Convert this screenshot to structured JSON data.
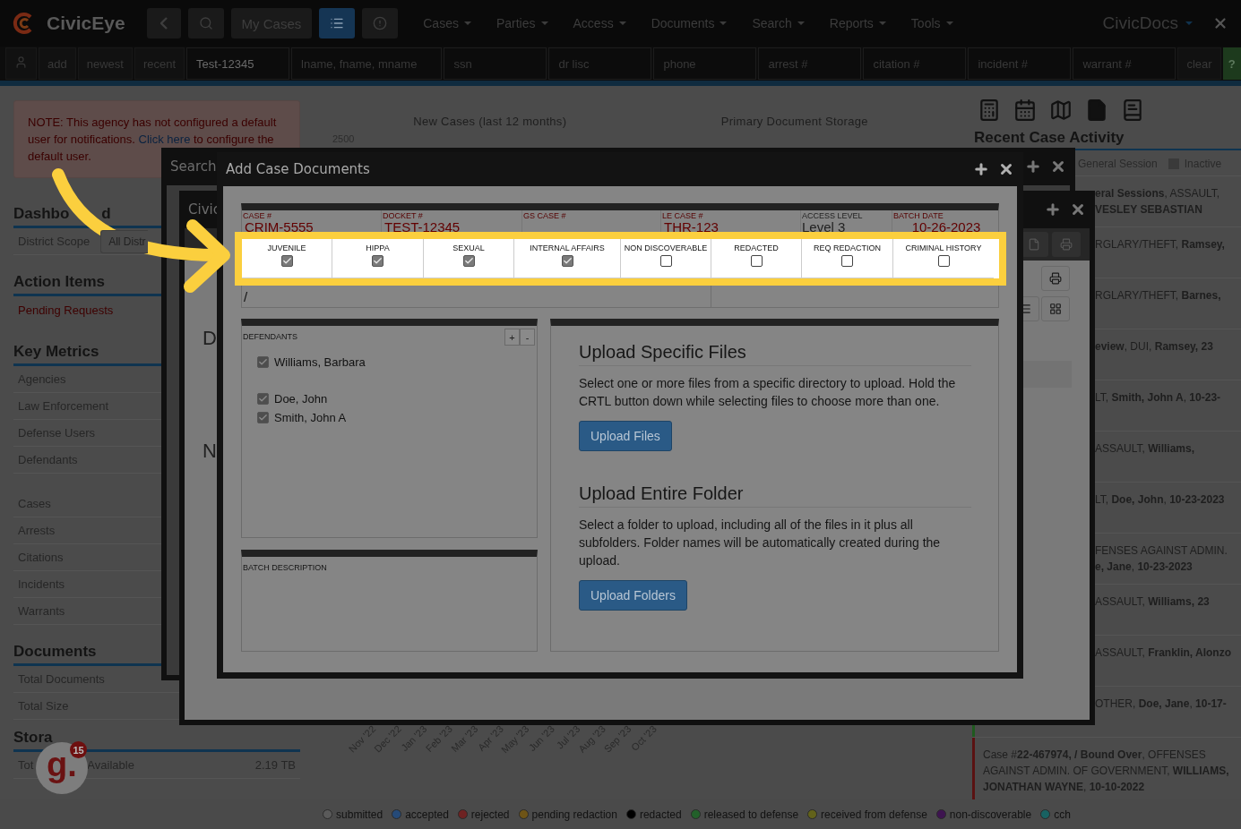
{
  "header": {
    "logo": "CivicEye",
    "tools": [
      {
        "kind": "back",
        "selected": false
      },
      {
        "kind": "search",
        "selected": false
      },
      {
        "kind": "text",
        "label": "My Cases",
        "selected": false
      },
      {
        "kind": "list",
        "selected": true
      },
      {
        "kind": "alert",
        "selected": false
      }
    ],
    "menus": [
      "Cases",
      "Parties",
      "Access",
      "Documents",
      "Search",
      "Reports",
      "Tools"
    ],
    "product": "CivicDocs"
  },
  "search_bar": {
    "buttons": [
      "add",
      "newest",
      "recent"
    ],
    "fields": [
      {
        "value": "Test-12345"
      },
      {
        "placeholder": "lname, fname, mname"
      },
      {
        "placeholder": "ssn"
      },
      {
        "placeholder": "dr lisc"
      },
      {
        "placeholder": "phone"
      },
      {
        "placeholder": "arrest #"
      },
      {
        "placeholder": "citation #"
      },
      {
        "placeholder": "incident #"
      },
      {
        "placeholder": "warrant #"
      }
    ],
    "clear": "clear",
    "help": "?"
  },
  "sidebar": {
    "notice": {
      "before": "NOTE: This agency has not configured a default user for notifications. ",
      "link": "Click here",
      "after": " to configure the default user."
    },
    "dashboard": {
      "title_parts": [
        "Dashbo",
        "d"
      ],
      "scope_label": "District Scope",
      "scope_value": "All Distr"
    },
    "action_items": {
      "title": "Action Items",
      "items": [
        "Pending Requests"
      ]
    },
    "key_metrics": {
      "title": "Key Metrics",
      "groups": [
        [
          "Agencies",
          "Law Enforcement",
          "Defense Users",
          "Defendants"
        ],
        [
          "Cases",
          "Arrests",
          "Citations",
          "Incidents",
          "Warrants"
        ]
      ]
    },
    "documents": {
      "title": "Documents",
      "items": [
        "Total Documents",
        "Total Size"
      ]
    },
    "storage": {
      "title": "Stora",
      "items": [
        {
          "label_parts": [
            "Tot",
            "Available"
          ],
          "value": "2.19 TB"
        }
      ]
    }
  },
  "center": {
    "chart_title": "New Cases (last 12 months)",
    "y_tick": "2500",
    "months": [
      "Nov '22",
      "Dec '22",
      "Jan '23",
      "Feb '23",
      "Mar '23",
      "Apr '23",
      "May '23",
      "Jun '23",
      "Jul '23",
      "Aug '23",
      "Sep '23",
      "Oct '23"
    ],
    "storage_title": "Primary Document Storage"
  },
  "activity": {
    "title": "Recent Case Activity",
    "legend": [
      "General Session",
      "Inactive"
    ],
    "items": [
      {
        "text": "**eral Sessions**, ASSAULT, **VESLEY SEBASTIAN**",
        "covered": true
      },
      {
        "text": "RGLARY/THEFT, **Ramsey,**",
        "covered": true
      },
      {
        "text": "RGLARY/THEFT, **Barnes,**",
        "covered": true
      },
      {
        "text": "**eview**, DUI, **Ramsey, 23**",
        "covered": true
      },
      {
        "text": "LT, **Smith, John A**, **10-23-**",
        "covered": true
      },
      {
        "text": "ASSAULT, **Williams,**",
        "covered": true
      },
      {
        "text": "LT, **Doe, John**, **10-23-2023**",
        "covered": true
      },
      {
        "text": "FENSES AGAINST ADMIN. **e, Jane**, **10-23-2023**",
        "covered": true
      },
      {
        "text": "ASSAULT, **Williams, 23**",
        "covered": true
      },
      {
        "text": "ASSAULT, **Franklin, Alonzo**",
        "covered": true
      },
      {
        "text": "OTHER, **Doe, Jane**, **10-17-**",
        "covered": true,
        "color": "#1f5a1f"
      },
      {
        "text": "Case #**22-467974, / Bound Over**, OFFENSES AGAINST ADMIN. OF GOVERNMENT, **WILLIAMS, JONATHAN WAYNE**, **10-10-2022**",
        "covered": false,
        "color": "#5a1212"
      }
    ]
  },
  "back_windows": [
    {
      "title": "Search"
    },
    {
      "title": "Civic",
      "letters": [
        "D",
        "N"
      ]
    }
  ],
  "modal": {
    "title": "Add Case Documents",
    "fields": [
      {
        "label": "CASE #",
        "value": "CRIM-5555"
      },
      {
        "label": "DOCKET #",
        "value": "TEST-12345"
      },
      {
        "label": "GS CASE #"
      },
      {
        "label": "LE CASE #",
        "value": "THR-123"
      },
      {
        "label": "ACCESS LEVEL",
        "value": "Level 3"
      },
      {
        "label": "BATCH DATE",
        "value": "10-26-2023"
      }
    ],
    "flags": [
      {
        "label": "JUVENILE",
        "checked": true
      },
      {
        "label": "HIPPA",
        "checked": true
      },
      {
        "label": "SEXUAL",
        "checked": true
      },
      {
        "label": "INTERNAL AFFAIRS",
        "checked": true
      },
      {
        "label": "NON DISCOVERABLE",
        "checked": false
      },
      {
        "label": "REDACTED",
        "checked": false
      },
      {
        "label": "REQ REDACTION",
        "checked": false
      },
      {
        "label": "CRIMINAL HISTORY",
        "checked": false
      }
    ],
    "path": "/",
    "defendants": {
      "label": "DEFENDANTS",
      "add": "+",
      "remove": "-",
      "items": [
        {
          "name": "Williams, Barbara",
          "checked": true
        },
        {
          "name": "Doe, John",
          "checked": true
        },
        {
          "name": "Smith, John A",
          "checked": true
        }
      ]
    },
    "batch_description": {
      "label": "BATCH DESCRIPTION"
    },
    "upload": [
      {
        "title": "Upload Specific Files",
        "text": "Select one or more files from a specific directory to upload. Hold the CRTL button down while selecting files to choose more than one.",
        "button": "Upload Files"
      },
      {
        "title": "Upload Entire Folder",
        "text": "Select a folder to upload, including all of the files in it plus all subfolders. Folder names will be automatically created during the upload.",
        "button": "Upload Folders"
      }
    ]
  },
  "status_legend": [
    {
      "label": "submitted",
      "color": "#5a5a5a"
    },
    {
      "label": "accepted",
      "color": "#254a78"
    },
    {
      "label": "rejected",
      "color": "#6e2222"
    },
    {
      "label": "pending redaction",
      "color": "#6e5416"
    },
    {
      "label": "redacted",
      "color": "#000000"
    },
    {
      "label": "released to defense",
      "color": "#22602a"
    },
    {
      "label": "received from defense",
      "color": "#62621a"
    },
    {
      "label": "non-discoverable",
      "color": "#3e1450"
    },
    {
      "label": "cch",
      "color": "#186262"
    }
  ],
  "badge": {
    "logo": "g.",
    "count": "15"
  }
}
